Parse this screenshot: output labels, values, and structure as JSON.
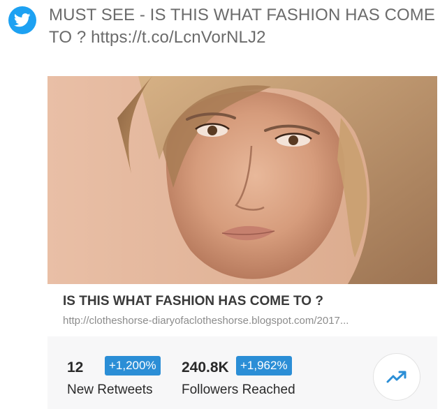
{
  "tweet": {
    "text": "MUST SEE -  IS THIS WHAT FASHION HAS COME TO ? https://t.co/LcnVorNLJ2",
    "icon": "twitter-bird-icon",
    "brand_color": "#1da1f2"
  },
  "card": {
    "image_alt": "close-up portrait photo",
    "title": "IS THIS WHAT FASHION HAS COME TO ?",
    "url": "http://clotheshorse-diaryofaclotheshorse.blogspot.com/2017..."
  },
  "stats": {
    "retweets": {
      "count": "12",
      "change": "+1,200%",
      "label": "New Retweets"
    },
    "followers": {
      "count": "240.8K",
      "change": "+1,962%",
      "label": "Followers Reached"
    },
    "badge_color": "#2b8ed6",
    "trend_icon": "trending-up-icon"
  }
}
